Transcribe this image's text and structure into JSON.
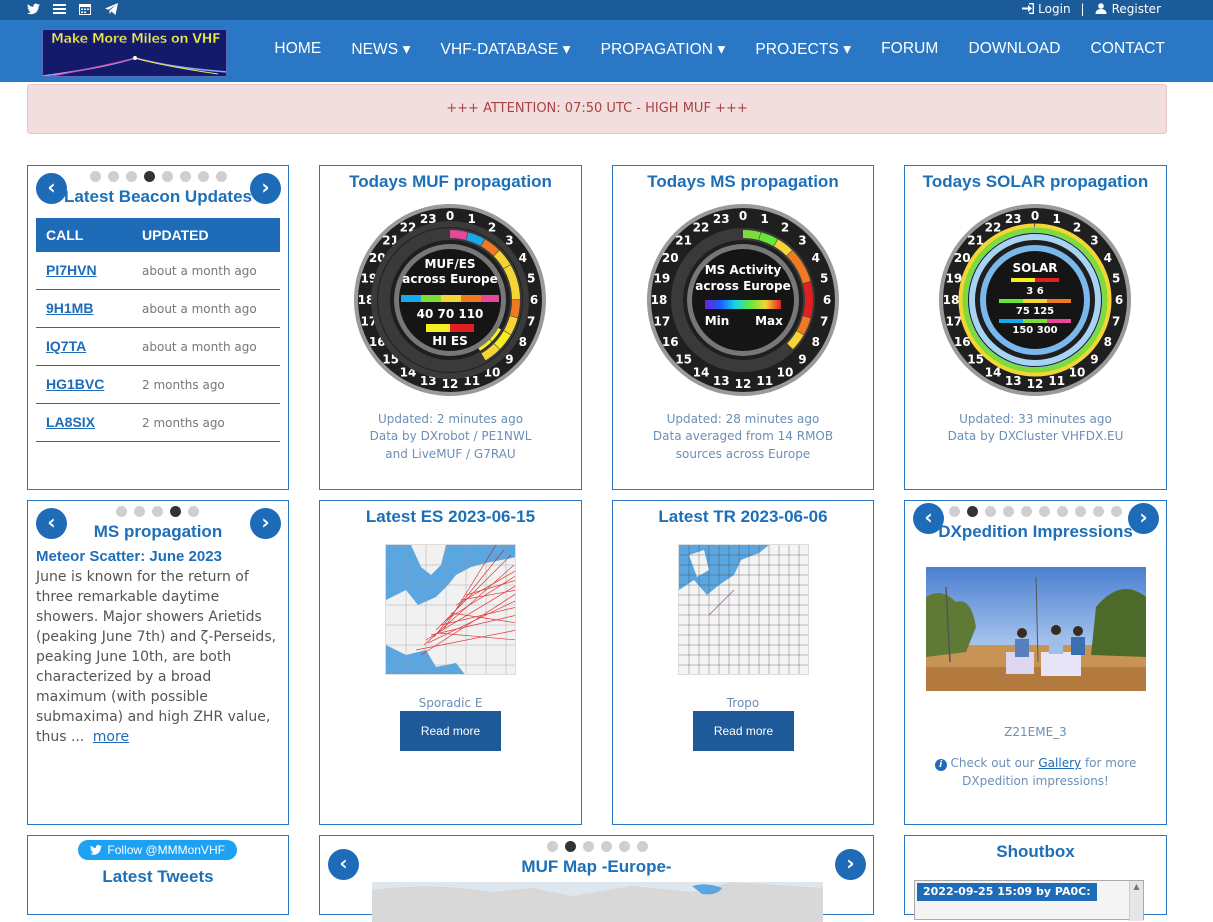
{
  "topbar": {
    "icons": [
      "twitter-icon",
      "list-icon",
      "calendar-icon",
      "telegram-icon"
    ],
    "login": "Login",
    "register": "Register",
    "separator": "|"
  },
  "header": {
    "logo_text": "Make More Miles on VHF",
    "nav": [
      "HOME",
      "NEWS ▾",
      "VHF-DATABASE ▾",
      "PROPAGATION ▾",
      "PROJECTS ▾",
      "FORUM",
      "DOWNLOAD",
      "CONTACT"
    ]
  },
  "alert": {
    "text": "+++ ATTENTION: 07:50 UTC - HIGH MUF +++"
  },
  "beacons": {
    "title": "Latest Beacon Updates",
    "col_call": "CALL",
    "col_updated": "UPDATED",
    "rows": [
      {
        "call": "PI7HVN",
        "updated": "about a month ago"
      },
      {
        "call": "9H1MB",
        "updated": "about a month ago"
      },
      {
        "call": "IQ7TA",
        "updated": "about a month ago"
      },
      {
        "call": "HG1BVC",
        "updated": "2 months ago"
      },
      {
        "call": "LA8SIX",
        "updated": "2 months ago"
      }
    ]
  },
  "muf": {
    "title": "Todays MUF propagation",
    "center_title_1": "MUF/ES",
    "center_title_2": "across Europe",
    "scale": "40  70  110",
    "legend": "HI   ES",
    "caption_1": "Updated: 2 minutes ago",
    "caption_2": "Data by DXrobot / PE1NWL",
    "caption_3": "and LiveMUF / G7RAU"
  },
  "ms": {
    "title": "Todays MS propagation",
    "center_title_1": "MS Activity",
    "center_title_2": "across Europe",
    "min": "Min",
    "max": "Max",
    "caption_1": "Updated: 28 minutes ago",
    "caption_2": "Data averaged from 14 RMOB",
    "caption_3": "sources across Europe"
  },
  "solar": {
    "title": "Todays SOLAR propagation",
    "center_title": "SOLAR",
    "line_1": "3  6",
    "line_2": "75  125",
    "line_3": "150  300",
    "caption_1": "Updated: 33 minutes ago",
    "caption_2": "Data by DXCluster VHFDX.EU"
  },
  "hours": [
    "23",
    "0",
    "1",
    "2",
    "3",
    "4",
    "5",
    "6",
    "7",
    "8",
    "9",
    "10",
    "11",
    "12",
    "13",
    "14",
    "15",
    "16",
    "17",
    "18",
    "19",
    "20",
    "21",
    "22"
  ],
  "ms_article": {
    "title": "MS propagation",
    "head": "Meteor Scatter: June 2023",
    "body": "June is known for the return of three remarkable daytime showers. Major showers Arietids (peaking June 7th) and ζ-Perseids, peaking June 10th, are both characterized by a broad maximum (with possible submaxima) and high ZHR value, thus ...",
    "more": "more"
  },
  "es": {
    "title": "Latest ES   2023-06-15",
    "caption": "Sporadic E",
    "button": "Read more"
  },
  "tr": {
    "title": "Latest TR   2023-06-06",
    "caption": "Tropo",
    "button": "Read more"
  },
  "dxped": {
    "title": "DXpedition Impressions",
    "caption": "Z21EME_3",
    "info_prefix": "Check out our",
    "gallery": "Gallery",
    "info_suffix": "for more",
    "info_line2": "DXpedition impressions!"
  },
  "tweets": {
    "follow": "Follow @MMMonVHF",
    "title": "Latest Tweets"
  },
  "mufmap": {
    "title": "MUF Map -Europe-"
  },
  "shoutbox": {
    "title": "Shoutbox",
    "msg": "2022-09-25 15:09 by PA0C:"
  },
  "colors": {
    "brand_blue": "#2a78c5",
    "dark_blue": "#1c5b9a",
    "alert_bg": "#f2dede",
    "alert_text": "#a94442"
  }
}
